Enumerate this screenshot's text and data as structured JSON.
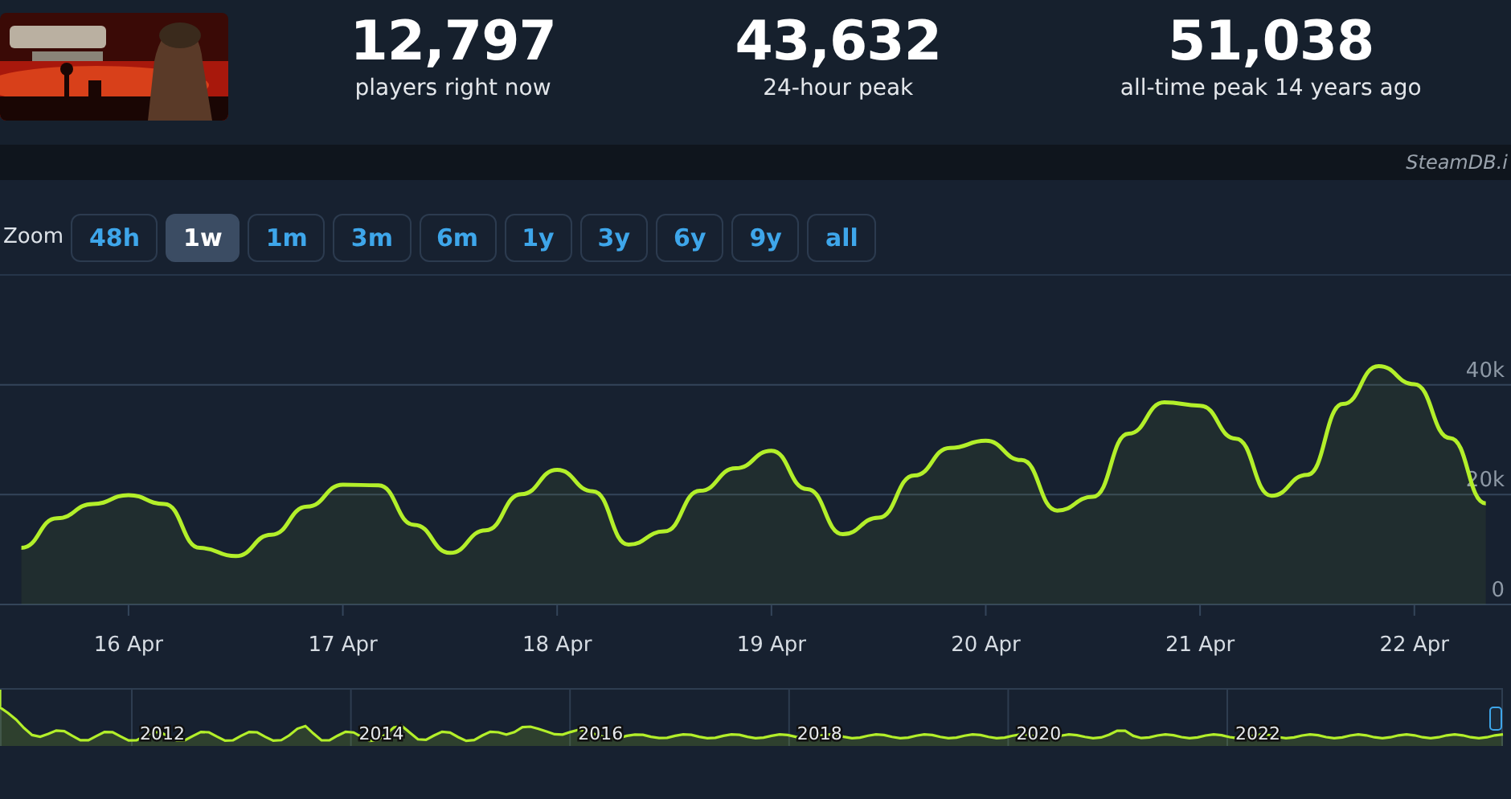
{
  "header": {
    "stats": [
      {
        "value": "12,797",
        "label": "players right now"
      },
      {
        "value": "43,632",
        "label": "24-hour peak"
      },
      {
        "value": "51,038",
        "label": "all-time peak 14 years ago"
      }
    ]
  },
  "credit": "SteamDB.i",
  "zoom": {
    "label": "Zoom",
    "buttons": [
      {
        "label": "48h",
        "selected": false
      },
      {
        "label": "1w",
        "selected": true
      },
      {
        "label": "1m",
        "selected": false
      },
      {
        "label": "3m",
        "selected": false
      },
      {
        "label": "6m",
        "selected": false
      },
      {
        "label": "1y",
        "selected": false
      },
      {
        "label": "3y",
        "selected": false
      },
      {
        "label": "6y",
        "selected": false
      },
      {
        "label": "9y",
        "selected": false
      },
      {
        "label": "all",
        "selected": false
      }
    ]
  },
  "chart": {
    "chart_data": {
      "type": "area",
      "categories": [
        null,
        null,
        null,
        "16 Apr",
        null,
        null,
        null,
        null,
        null,
        "17 Apr",
        null,
        null,
        null,
        null,
        null,
        "18 Apr",
        null,
        null,
        null,
        null,
        null,
        "19 Apr",
        null,
        null,
        null,
        null,
        null,
        "20 Apr",
        null,
        null,
        null,
        null,
        null,
        "21 Apr",
        null,
        null,
        null,
        null,
        null,
        "22 Apr",
        null,
        null
      ],
      "series": [
        {
          "color": "#b3ef2a",
          "values": [
            10300,
            15700,
            18300,
            19900,
            18300,
            10300,
            8800,
            12700,
            17800,
            21800,
            21700,
            14500,
            9400,
            13500,
            20100,
            24500,
            20600,
            10900,
            13300,
            20700,
            24800,
            28000,
            21000,
            12800,
            15800,
            23500,
            28500,
            29800,
            26300,
            17100,
            19600,
            31100,
            36800,
            36200,
            30200,
            19800,
            23600,
            36500,
            43400,
            40100,
            30300,
            18400
          ]
        }
      ],
      "ylim": [
        0,
        60000
      ],
      "yticks": [
        {
          "value": 0,
          "label": "0"
        },
        {
          "value": 20000,
          "label": "20k"
        },
        {
          "value": 40000,
          "label": "40k"
        }
      ]
    }
  },
  "navigator": {
    "labels": [
      "2012",
      "2014",
      "2016",
      "2018",
      "2020",
      "2022"
    ]
  }
}
